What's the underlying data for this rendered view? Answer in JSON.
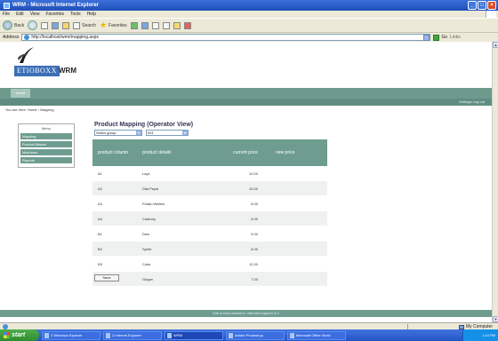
{
  "window": {
    "title": "WRM - Microsoft Internet Explorer",
    "min": "_",
    "max": "□",
    "close": "×"
  },
  "menubar": [
    "File",
    "Edit",
    "View",
    "Favorites",
    "Tools",
    "Help"
  ],
  "toolbar": {
    "back": "Back",
    "search": "Search",
    "favorites": "Favorites"
  },
  "addressbar": {
    "label": "Address",
    "url": "http://localhost/wrm/mapping.aspx",
    "go": "Go",
    "links": "Links"
  },
  "page": {
    "logo_box": "ETIOBOXX",
    "logo_text": "WRM",
    "nav_tab": "Home",
    "user_links": "Settings  Log out",
    "welcome": "You are here: Home › Mapping"
  },
  "leftnav": {
    "header": "Menu",
    "items": [
      "Mapping",
      "Product Master",
      "Machines",
      "Reports"
    ]
  },
  "main": {
    "title": "Product Mapping (Operator View)",
    "select1": "Select group",
    "select2": "001",
    "save_label": "Save"
  },
  "grid": {
    "columns": [
      "product column",
      "product details",
      "current price",
      "new price"
    ],
    "rows": [
      {
        "col": "A1",
        "details": "Lays",
        "price": "10.00",
        "new": ""
      },
      {
        "col": "A2",
        "details": "Dita Pepsi",
        "price": "10.00",
        "new": ""
      },
      {
        "col": "A3",
        "details": "Potato Wafers",
        "price": "8.00",
        "new": ""
      },
      {
        "col": "A4",
        "details": "Cadbury",
        "price": "5.00",
        "new": ""
      },
      {
        "col": "B1",
        "details": "Dew",
        "price": "5.00",
        "new": ""
      },
      {
        "col": "B2",
        "details": "Sprite",
        "price": "8.00",
        "new": ""
      },
      {
        "col": "B3",
        "details": "Coke",
        "price": "12.00",
        "new": ""
      },
      {
        "col": "B4",
        "details": "Ginger",
        "price": "7.00",
        "new": ""
      }
    ]
  },
  "footer": "Site is best viewed in Internet Explorer 6.0",
  "statusbar": {
    "zone": "My Computer"
  },
  "taskbar": {
    "start": "start",
    "tasks": [
      "2 Windows Explorer",
      "2 Internet Explorer",
      "WRM",
      "Adobe Photoshop",
      "Microsoft Office Word"
    ],
    "clock": "1:10 PM"
  },
  "colors": {
    "accent": "#6e9d8f",
    "titlebar": "#2f5fc8",
    "logo": "#3d6fb6"
  }
}
